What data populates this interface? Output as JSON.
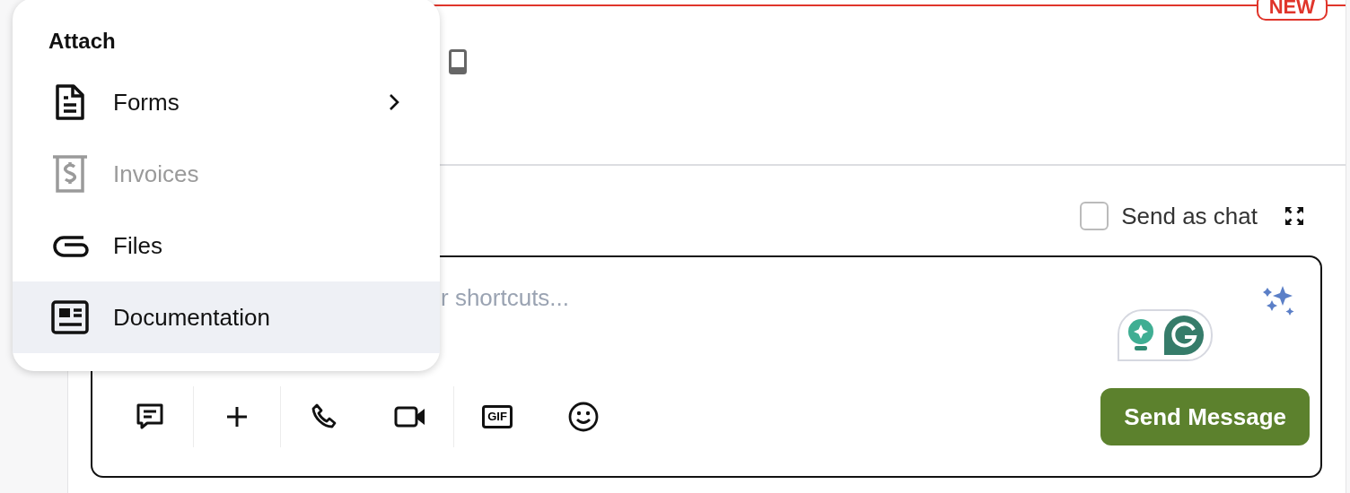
{
  "header": {
    "badge": "NEW"
  },
  "attach_menu": {
    "title": "Attach",
    "items": [
      {
        "label": "Forms",
        "kind": "form",
        "submenu": true,
        "disabled": false,
        "selected": false
      },
      {
        "label": "Invoices",
        "kind": "invoice",
        "submenu": false,
        "disabled": true,
        "selected": false
      },
      {
        "label": "Files",
        "kind": "clip",
        "submenu": false,
        "disabled": false,
        "selected": false
      },
      {
        "label": "Documentation",
        "kind": "doc",
        "submenu": false,
        "disabled": false,
        "selected": true
      }
    ]
  },
  "composer": {
    "send_as_chat": {
      "label": "Send as chat",
      "checked": false
    },
    "placeholder": "r shortcuts...",
    "toolbar_groups": [
      [
        {
          "kind": "note"
        }
      ],
      [
        {
          "kind": "plus"
        }
      ],
      [
        {
          "kind": "phone"
        },
        {
          "kind": "video"
        }
      ],
      [
        {
          "kind": "gif",
          "label": "GIF"
        },
        {
          "kind": "emoji"
        }
      ]
    ],
    "send_button": "Send Message"
  }
}
